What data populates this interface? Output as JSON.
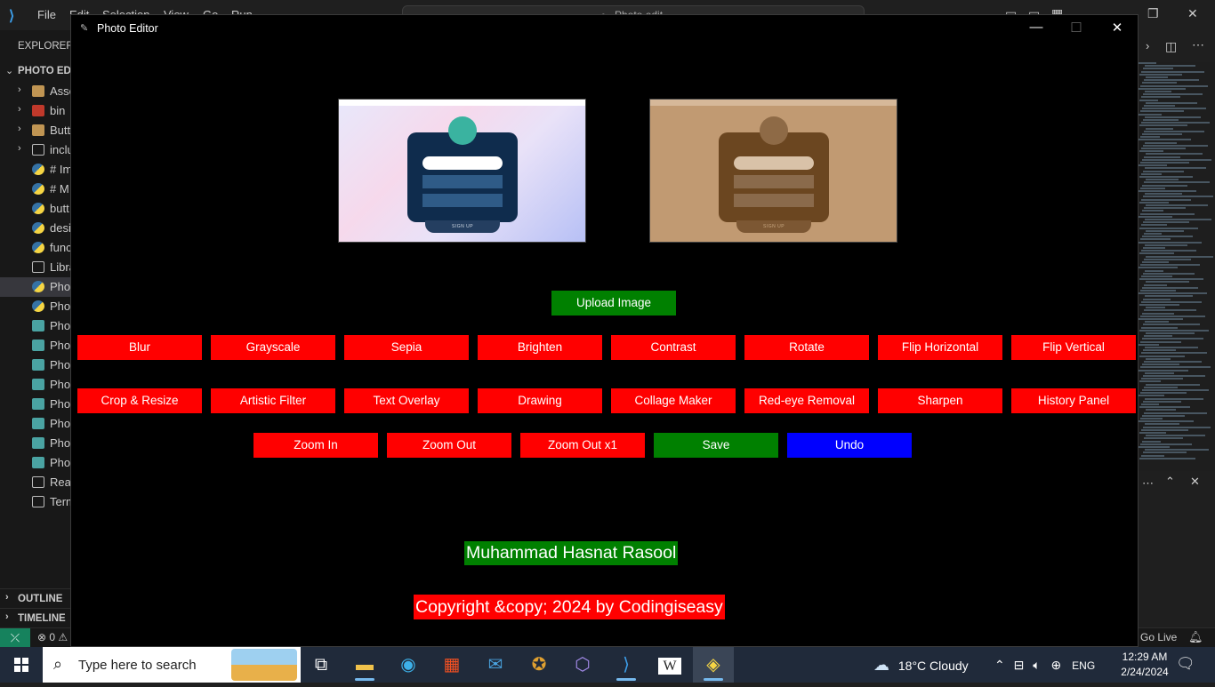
{
  "vscode": {
    "menu": [
      "File",
      "Edit",
      "Selection",
      "View",
      "Go",
      "Run"
    ],
    "search_placeholder": "Photo edit...",
    "explorer_label": "EXPLORER",
    "project_label": "PHOTO EDI",
    "files": [
      {
        "name": "Asse",
        "icon": "folder-icon",
        "chevron": true
      },
      {
        "name": "bin",
        "icon": "bin-folder-icon",
        "chevron": true
      },
      {
        "name": "Butt",
        "icon": "folder-icon",
        "chevron": true
      },
      {
        "name": "inclu",
        "icon": "include-folder-icon",
        "chevron": true
      },
      {
        "name": "# Im",
        "icon": "python-file-icon",
        "chevron": false
      },
      {
        "name": "# M",
        "icon": "python-file-icon",
        "chevron": false
      },
      {
        "name": "butt",
        "icon": "python-file-icon",
        "chevron": false
      },
      {
        "name": "desi",
        "icon": "python-file-icon",
        "chevron": false
      },
      {
        "name": "func",
        "icon": "python-file-icon",
        "chevron": false
      },
      {
        "name": "Libra",
        "icon": "text-file-icon",
        "chevron": false
      },
      {
        "name": "Pho",
        "icon": "python-file-icon",
        "chevron": false,
        "selected": true
      },
      {
        "name": "Pho",
        "icon": "python-file-icon",
        "chevron": false
      },
      {
        "name": "Pho",
        "icon": "image-file-icon",
        "chevron": false
      },
      {
        "name": "Pho",
        "icon": "image-file-icon",
        "chevron": false
      },
      {
        "name": "Pho",
        "icon": "image-file-icon",
        "chevron": false
      },
      {
        "name": "Pho",
        "icon": "image-file-icon",
        "chevron": false
      },
      {
        "name": "Pho",
        "icon": "image-file-icon",
        "chevron": false
      },
      {
        "name": "Pho",
        "icon": "image-file-icon",
        "chevron": false
      },
      {
        "name": "Pho",
        "icon": "image-file-icon",
        "chevron": false
      },
      {
        "name": "Pho",
        "icon": "image-file-icon",
        "chevron": false
      },
      {
        "name": "Read",
        "icon": "text-file-icon",
        "chevron": false
      },
      {
        "name": "Term",
        "icon": "text-file-icon",
        "chevron": false
      }
    ],
    "outline_label": "OUTLINE",
    "timeline_label": "TIMELINE",
    "status_errors": "⊗ 0 ⚠",
    "go_live": "Go Live"
  },
  "editor": {
    "window_title": "Photo Editor",
    "preview_caption_original": "SIGN UP",
    "preview_caption_edited": "SIGN UP",
    "upload_button": "Upload Image",
    "row1": [
      "Blur",
      "Grayscale",
      "Sepia",
      "Brighten",
      "Contrast",
      "Rotate",
      "Flip Horizontal",
      "Flip Vertical"
    ],
    "row2": [
      "Crop & Resize",
      "Artistic Filter",
      "Text Overlay",
      "Drawing",
      "Collage Maker",
      "Red-eye Removal",
      "Sharpen",
      "History Panel"
    ],
    "row3": {
      "zoom_in": "Zoom In",
      "zoom_out": "Zoom Out",
      "zoom_out_x1": "Zoom Out x1",
      "save": "Save",
      "undo": "Undo"
    },
    "author": "Muhammad Hasnat Rasool",
    "copyright": "Copyright &copy; 2024 by Codingiseasy",
    "colors": {
      "red": "#ff0000",
      "green": "#008000",
      "blue": "#0000ff",
      "background": "#000000"
    }
  },
  "taskbar": {
    "search_placeholder": "Type here to search",
    "weather": "18°C  Cloudy",
    "language": "ENG",
    "time": "12:29 AM",
    "date": "2/24/2024"
  }
}
